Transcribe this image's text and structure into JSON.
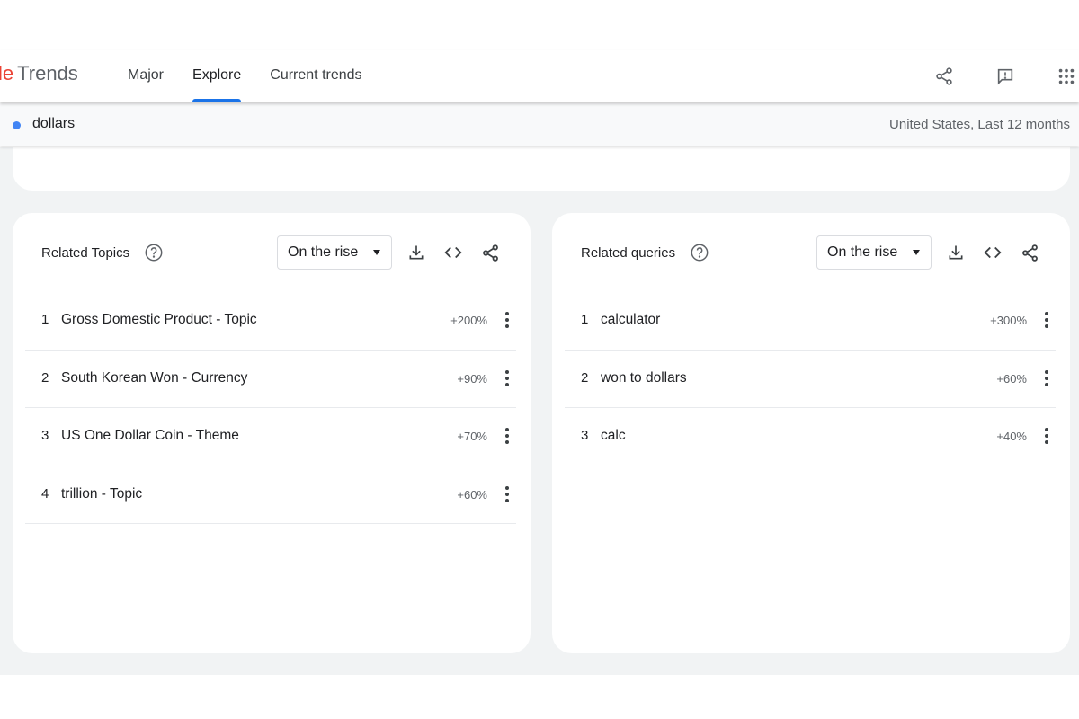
{
  "header": {
    "logo_part1": "l",
    "logo_part2": "e",
    "logo_text": "Trends",
    "nav": [
      {
        "label": "Major"
      },
      {
        "label": "Explore",
        "active": true
      },
      {
        "label": "Current trends"
      }
    ],
    "icons": [
      "share-icon",
      "feedback-icon",
      "apps-grid-icon"
    ]
  },
  "search": {
    "term": "dollars",
    "term_color": "#4285f4",
    "meta": "United States, Last 12 months"
  },
  "panels": {
    "topics": {
      "title": "Related Topics",
      "dropdown": "On the rise",
      "rows": [
        {
          "rank": "1",
          "name": "Gross Domestic Product - Topic",
          "value": "+200%"
        },
        {
          "rank": "2",
          "name": "South Korean Won - Currency",
          "value": "+90%"
        },
        {
          "rank": "3",
          "name": "US One Dollar Coin - Theme",
          "value": "+70%"
        },
        {
          "rank": "4",
          "name": "trillion - Topic",
          "value": "+60%"
        }
      ]
    },
    "queries": {
      "title": "Related queries",
      "dropdown": "On the rise",
      "rows": [
        {
          "rank": "1",
          "name": "calculator",
          "value": "+300%"
        },
        {
          "rank": "2",
          "name": "won to dollars",
          "value": "+60%"
        },
        {
          "rank": "3",
          "name": "calc",
          "value": "+40%"
        }
      ]
    }
  },
  "colors": {
    "accent": "#1a73e8",
    "background": "#f1f3f4",
    "text": "#202124",
    "muted": "#5f6368"
  }
}
